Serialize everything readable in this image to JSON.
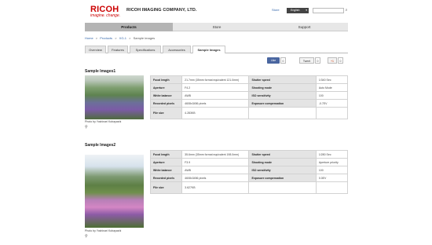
{
  "header": {
    "logo_word": "RICOH",
    "logo_tagline": "imagine. change.",
    "company": "RICOH IMAGING COMPANY, LTD.",
    "store_link": "Store",
    "language": "English",
    "search_placeholder": ""
  },
  "nav": {
    "items": [
      {
        "label": "Products"
      },
      {
        "label": "Store"
      },
      {
        "label": "Support"
      }
    ]
  },
  "breadcrumb": {
    "items": [
      "Home",
      "Products",
      "XG-1",
      "Sample images"
    ],
    "separator": ">"
  },
  "tabs": {
    "items": [
      {
        "label": "Overview"
      },
      {
        "label": "Features"
      },
      {
        "label": "Specifications"
      },
      {
        "label": "Accessories"
      },
      {
        "label": "Sample Images"
      }
    ]
  },
  "social": {
    "like_label": "Like",
    "like_count": "0",
    "tweet_label": "Tweet",
    "tweet_count": "0",
    "gplus_label": "+1",
    "gplus_count": "0"
  },
  "samples": [
    {
      "title": "Sample Images1",
      "credit": "Photo by Yoshinari Kobayashi",
      "rows": [
        [
          "Focal length",
          "21.7mm (35mm format equivalent 121.0mm)",
          "Shutter speed",
          "1/340 Sec"
        ],
        [
          "Aperture",
          "F4.2",
          "Shooting mode",
          "Auto Mode"
        ],
        [
          "White balance",
          "AWB",
          "ISO sensitivity",
          "100"
        ],
        [
          "Recorded pixels",
          "4608x3456 pixels",
          "Exposure compensation",
          "-0.7EV"
        ],
        [
          "File size",
          "4.283KB",
          "",
          ""
        ]
      ]
    },
    {
      "title": "Sample Images2",
      "credit": "Photo by Yoshinari Kobayashi",
      "rows": [
        [
          "Focal length",
          "35.6mm (35mm format equivalent 198.0mm)",
          "Shutter speed",
          "1/280 Sec"
        ],
        [
          "Aperture",
          "F3.9",
          "Shooting mode",
          "Aperture priority"
        ],
        [
          "White balance",
          "AWB",
          "ISO sensitivity",
          "100"
        ],
        [
          "Recorded pixels",
          "4608x3456 pixels",
          "Exposure compensation",
          "0.0EV"
        ],
        [
          "File size",
          "3.627KB",
          "",
          ""
        ]
      ]
    }
  ]
}
